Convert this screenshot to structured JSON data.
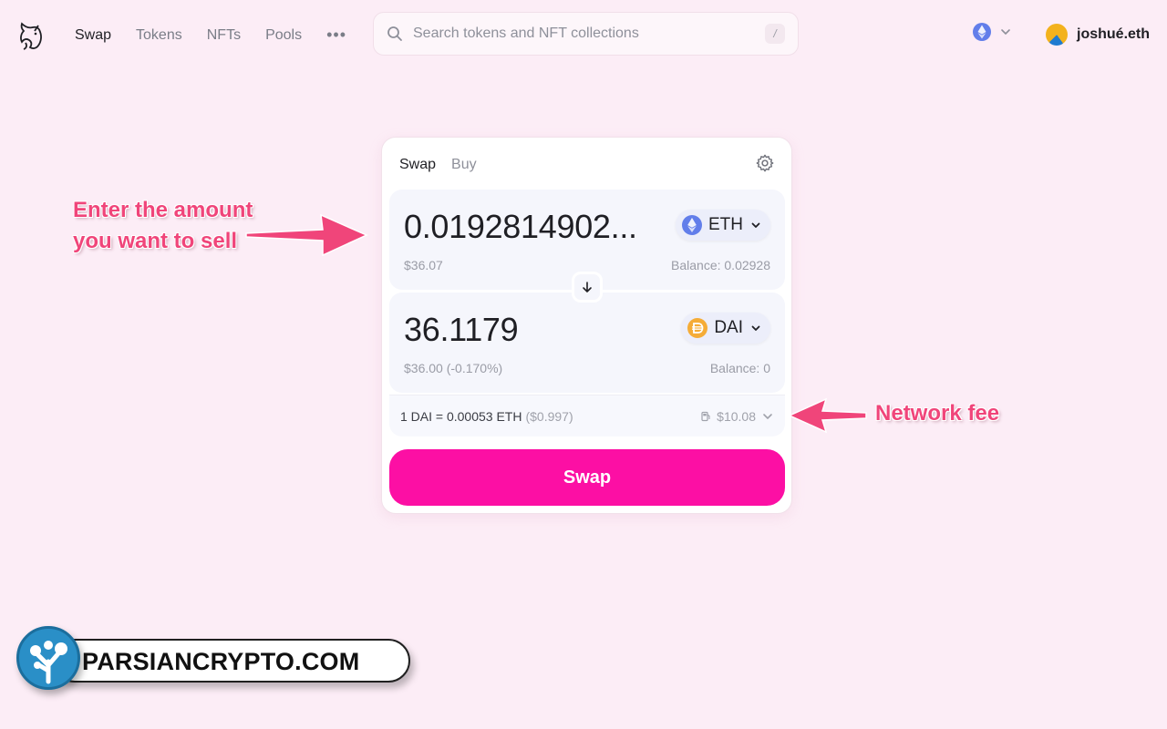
{
  "nav": {
    "items": [
      {
        "label": "Swap",
        "active": true
      },
      {
        "label": "Tokens",
        "active": false
      },
      {
        "label": "NFTs",
        "active": false
      },
      {
        "label": "Pools",
        "active": false
      }
    ],
    "more_label": "•••"
  },
  "search": {
    "placeholder": "Search tokens and NFT collections",
    "shortcut": "/"
  },
  "account": {
    "name": "joshué.eth"
  },
  "card": {
    "tabs": [
      {
        "label": "Swap",
        "active": true
      },
      {
        "label": "Buy",
        "active": false
      }
    ],
    "sell": {
      "amount": "0.0192814902...",
      "token": "ETH",
      "usd_value": "$36.07",
      "balance": "Balance: 0.02928"
    },
    "buy": {
      "amount": "36.1179",
      "token": "DAI",
      "usd_value": "$36.00 (-0.170%)",
      "balance": "Balance: 0"
    },
    "rate": {
      "text": "1 DAI = 0.00053 ETH",
      "usd": "($0.997)"
    },
    "fee": "$10.08",
    "swap_button": "Swap"
  },
  "annotations": {
    "sell_line1": "Enter the amount",
    "sell_line2": "you want to sell",
    "fee": "Network fee"
  },
  "watermark": {
    "text": "PARSIANCRYPTO.COM"
  },
  "colors": {
    "background": "#fcedf6",
    "accent": "#fc0fa4",
    "annotation": "#f0457a",
    "eth": "#627eea",
    "dai": "#f5ac37"
  }
}
